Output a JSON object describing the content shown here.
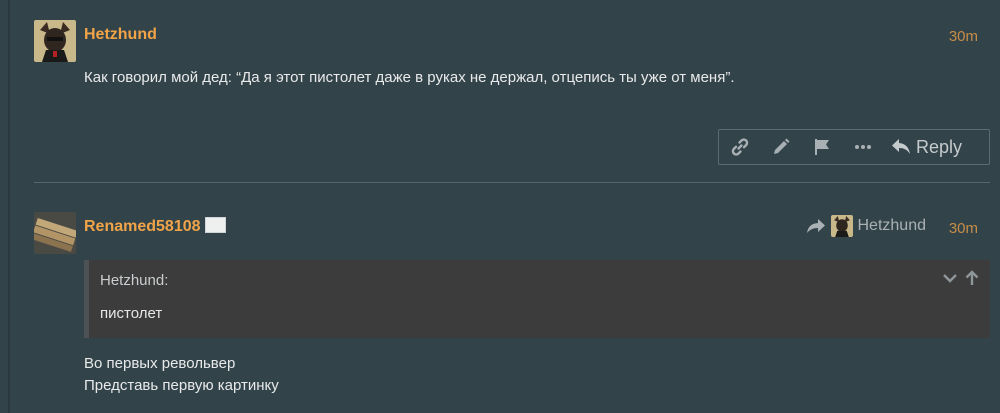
{
  "posts": [
    {
      "username": "Hetzhund",
      "time": "30m",
      "text": "Как говорил мой дед: “Да я этот пистолет даже в руках не держал, отцепись ты уже от меня”.",
      "actions": {
        "icons": [
          "link-icon",
          "pencil-icon",
          "flag-icon",
          "more-icon"
        ],
        "reply_label": "Reply"
      }
    },
    {
      "username": "Renamed58108",
      "time": "30m",
      "reply_to": "Hetzhund",
      "quote": {
        "author": "Hetzhund:",
        "text": "пистолет"
      },
      "lines": [
        "Во первых револьвер",
        "Представь первую картинку"
      ]
    }
  ],
  "colors": {
    "background": "#33434a",
    "username": "#f0a447",
    "timestamp": "#c68d45",
    "quote_bg": "#3c3c3c"
  }
}
